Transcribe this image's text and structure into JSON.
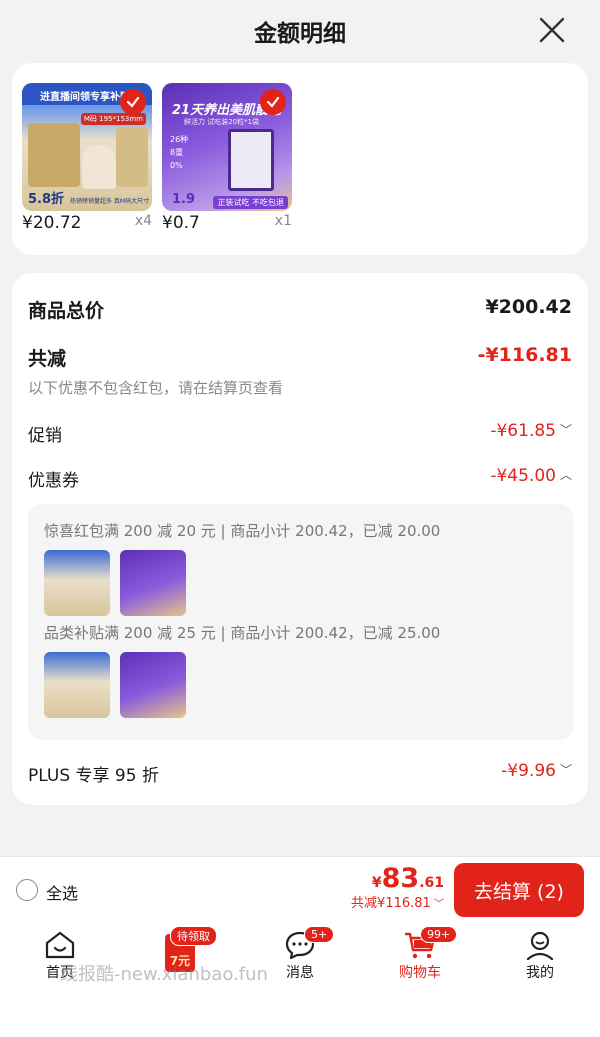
{
  "header": {
    "title": "金额明细"
  },
  "products": [
    {
      "banner": "进直播间领专享补贴券",
      "size_tag": "M码 195*153mm",
      "discount": "5.8折",
      "caption": "热销榜销量超多 真M码大尺寸",
      "price": "¥20.72",
      "qty": "x4"
    },
    {
      "banner": "21天养出美肌靓毛",
      "sub": "鲜活力 试吃装20粒*1袋",
      "stat1": "26种",
      "stat2": "8重",
      "stat3": "0%",
      "price_tag": "1.9",
      "tagline": "正装试吃 不吃包退",
      "price": "¥0.7",
      "qty": "x1"
    }
  ],
  "summary": {
    "total_label": "商品总价",
    "total_value": "¥200.42",
    "reduce_label": "共减",
    "reduce_value": "-¥116.81",
    "note": "以下优惠不包含红包，请在结算页查看",
    "promo_label": "促销",
    "promo_value": "-¥61.85",
    "coupon_label": "优惠券",
    "coupon_value": "-¥45.00",
    "coupon1": "惊喜红包满 200 减 20 元 | 商品小计 200.42，已减 20.00",
    "coupon2": "品类补贴满 200 减 25 元 | 商品小计 200.42，已减 25.00",
    "plus_label": "PLUS 专享 95 折",
    "plus_value": "-¥9.96"
  },
  "bottom": {
    "select_all": "全选",
    "currency": "¥",
    "amount_int": "83",
    "amount_dec": ".61",
    "reduce": "共减¥116.81",
    "checkout": "去结算 (2)"
  },
  "tabs": [
    {
      "label": "首页"
    },
    {
      "label": "7元",
      "badge": "待领取"
    },
    {
      "label": "消息",
      "badge": "5+"
    },
    {
      "label": "购物车",
      "badge": "99+"
    },
    {
      "label": "我的"
    }
  ],
  "watermark": "线报酷-new.xianbao.fun",
  "colors": {
    "accent": "#e2231a",
    "background": "#f2f2f2"
  }
}
